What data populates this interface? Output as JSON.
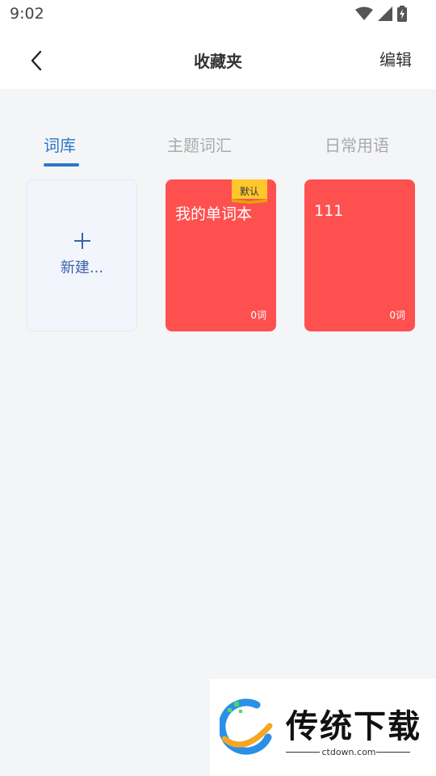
{
  "status_bar": {
    "time": "9:02"
  },
  "header": {
    "title": "收藏夹",
    "edit_label": "编辑"
  },
  "tabs": [
    {
      "label": "词库",
      "active": true
    },
    {
      "label": "主题词汇",
      "active": false
    },
    {
      "label": "日常用语",
      "active": false
    }
  ],
  "new_card": {
    "label": "新建..."
  },
  "cards": [
    {
      "name": "我的单词本",
      "count": "0词",
      "badge": "默认",
      "color": "#ff5050"
    },
    {
      "name": "111",
      "count": "0词",
      "color": "#ff5050"
    }
  ],
  "watermark": {
    "brand": "传统下载",
    "url": "ctdown.com"
  },
  "colors": {
    "accent": "#2b78c9",
    "card_red": "#ff5050",
    "badge_yellow": "#ffc72c"
  }
}
